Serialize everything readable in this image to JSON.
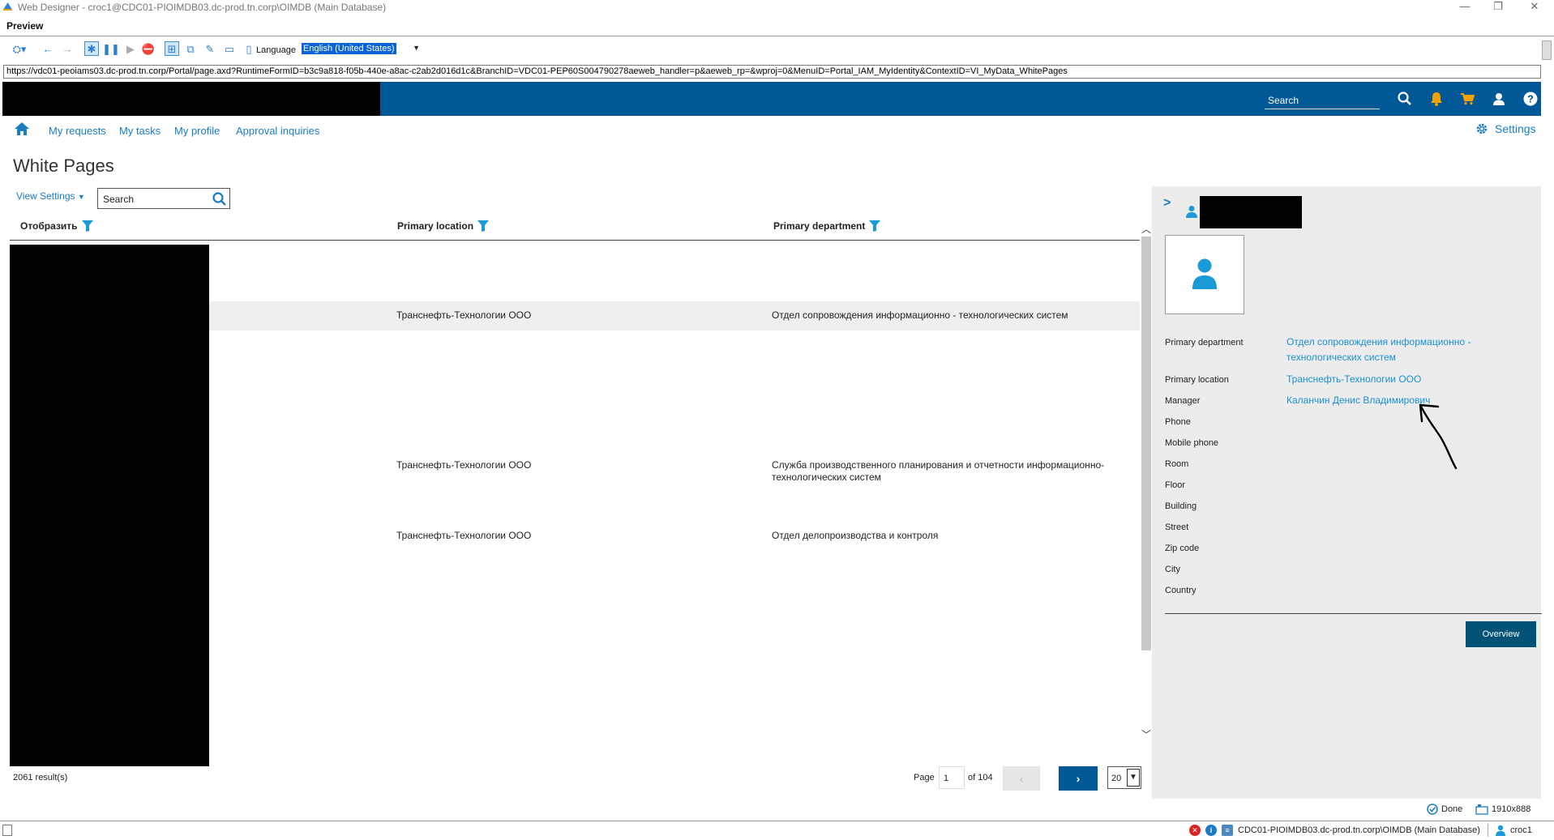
{
  "window": {
    "title": "Web Designer - croc1@CDC01-PIOIMDB03.dc-prod.tn.corp\\OIMDB (Main Database)",
    "preview_label": "Preview",
    "minimize": "—",
    "restore": "❐",
    "close": "✕"
  },
  "toolbar": {
    "language_label": "Language",
    "language_value": "English (United States)"
  },
  "url": "https://vdc01-peoiams03.dc-prod.tn.corp/Portal/page.axd?RuntimeFormID=b3c9a818-f05b-440e-a8ac-c2ab2d016d1c&BranchID=VDC01-PEP60S004790278aeweb_handler=p&aeweb_rp=&wproj=0&MenuID=Portal_IAM_MyIdentity&ContextID=VI_MyData_WhitePages",
  "header": {
    "search_placeholder": "Search"
  },
  "nav": {
    "items": [
      "My requests",
      "My tasks",
      "My profile",
      "Approval inquiries"
    ],
    "settings": "Settings"
  },
  "page": {
    "title": "White Pages",
    "view_settings": "View Settings",
    "search_placeholder": "Search"
  },
  "table": {
    "columns": [
      "Отобразить",
      "Primary location",
      "Primary department"
    ],
    "rows": [
      {
        "location": "",
        "department": ""
      },
      {
        "location": "Транснефть-Технологии ООО",
        "department": "Отдел сопровождения информационно - технологических систем"
      },
      {
        "location": "",
        "department": ""
      },
      {
        "location": "Транснефть-Технологии ООО",
        "department": "Служба производственного планирования и отчетности информационно-технологических систем"
      },
      {
        "location": "Транснефть-Технологии ООО",
        "department": "Отдел делопроизводства и контроля"
      }
    ]
  },
  "pager": {
    "results": "2061 result(s)",
    "page_label": "Page",
    "page": "1",
    "of": "of 104",
    "page_size": "20"
  },
  "detail": {
    "labels": [
      "Primary department",
      "Primary location",
      "Manager",
      "Phone",
      "Mobile phone",
      "Room",
      "Floor",
      "Building",
      "Street",
      "Zip code",
      "City",
      "Country"
    ],
    "primary_department": "Отдел сопровождения информационно - технологических систем",
    "primary_location": "Транснефть-Технологии ООО",
    "manager": "Каланчин Денис Владимирович",
    "overview_button": "Overview"
  },
  "status": {
    "done": "Done",
    "resolution": "1910x888",
    "connection": "CDC01-PIOIMDB03.dc-prod.tn.corp\\OIMDB (Main Database)",
    "user": "croc1"
  },
  "colors": {
    "header_blue": "#005896",
    "link_blue": "#1a7dc2",
    "accent_cyan": "#1a9ad6",
    "orange": "#f5a100"
  }
}
